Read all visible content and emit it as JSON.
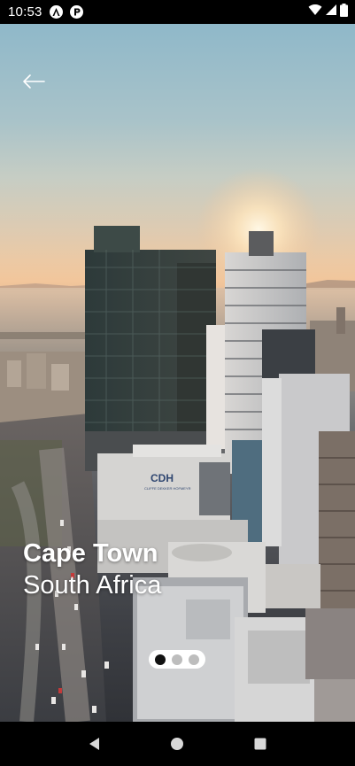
{
  "status_bar": {
    "time": "10:53",
    "left_icons": [
      "app-a-icon",
      "app-p-icon"
    ],
    "right_icons": [
      "wifi-icon",
      "signal-icon",
      "battery-icon"
    ]
  },
  "hero": {
    "city": "Cape Town",
    "country": "South Africa",
    "building_sign": "CDH",
    "building_subsign": "CLIFFE DEKKER HOFMEYR"
  },
  "pager": {
    "count": 3,
    "active_index": 0
  },
  "nav_bar": {
    "buttons": [
      "back-triangle-icon",
      "home-circle-icon",
      "recents-square-icon"
    ]
  },
  "colors": {
    "status_bar": "#000000",
    "title_text": "#ffffff",
    "pager_active": "#111111",
    "pager_inactive": "#bdbdbd"
  }
}
